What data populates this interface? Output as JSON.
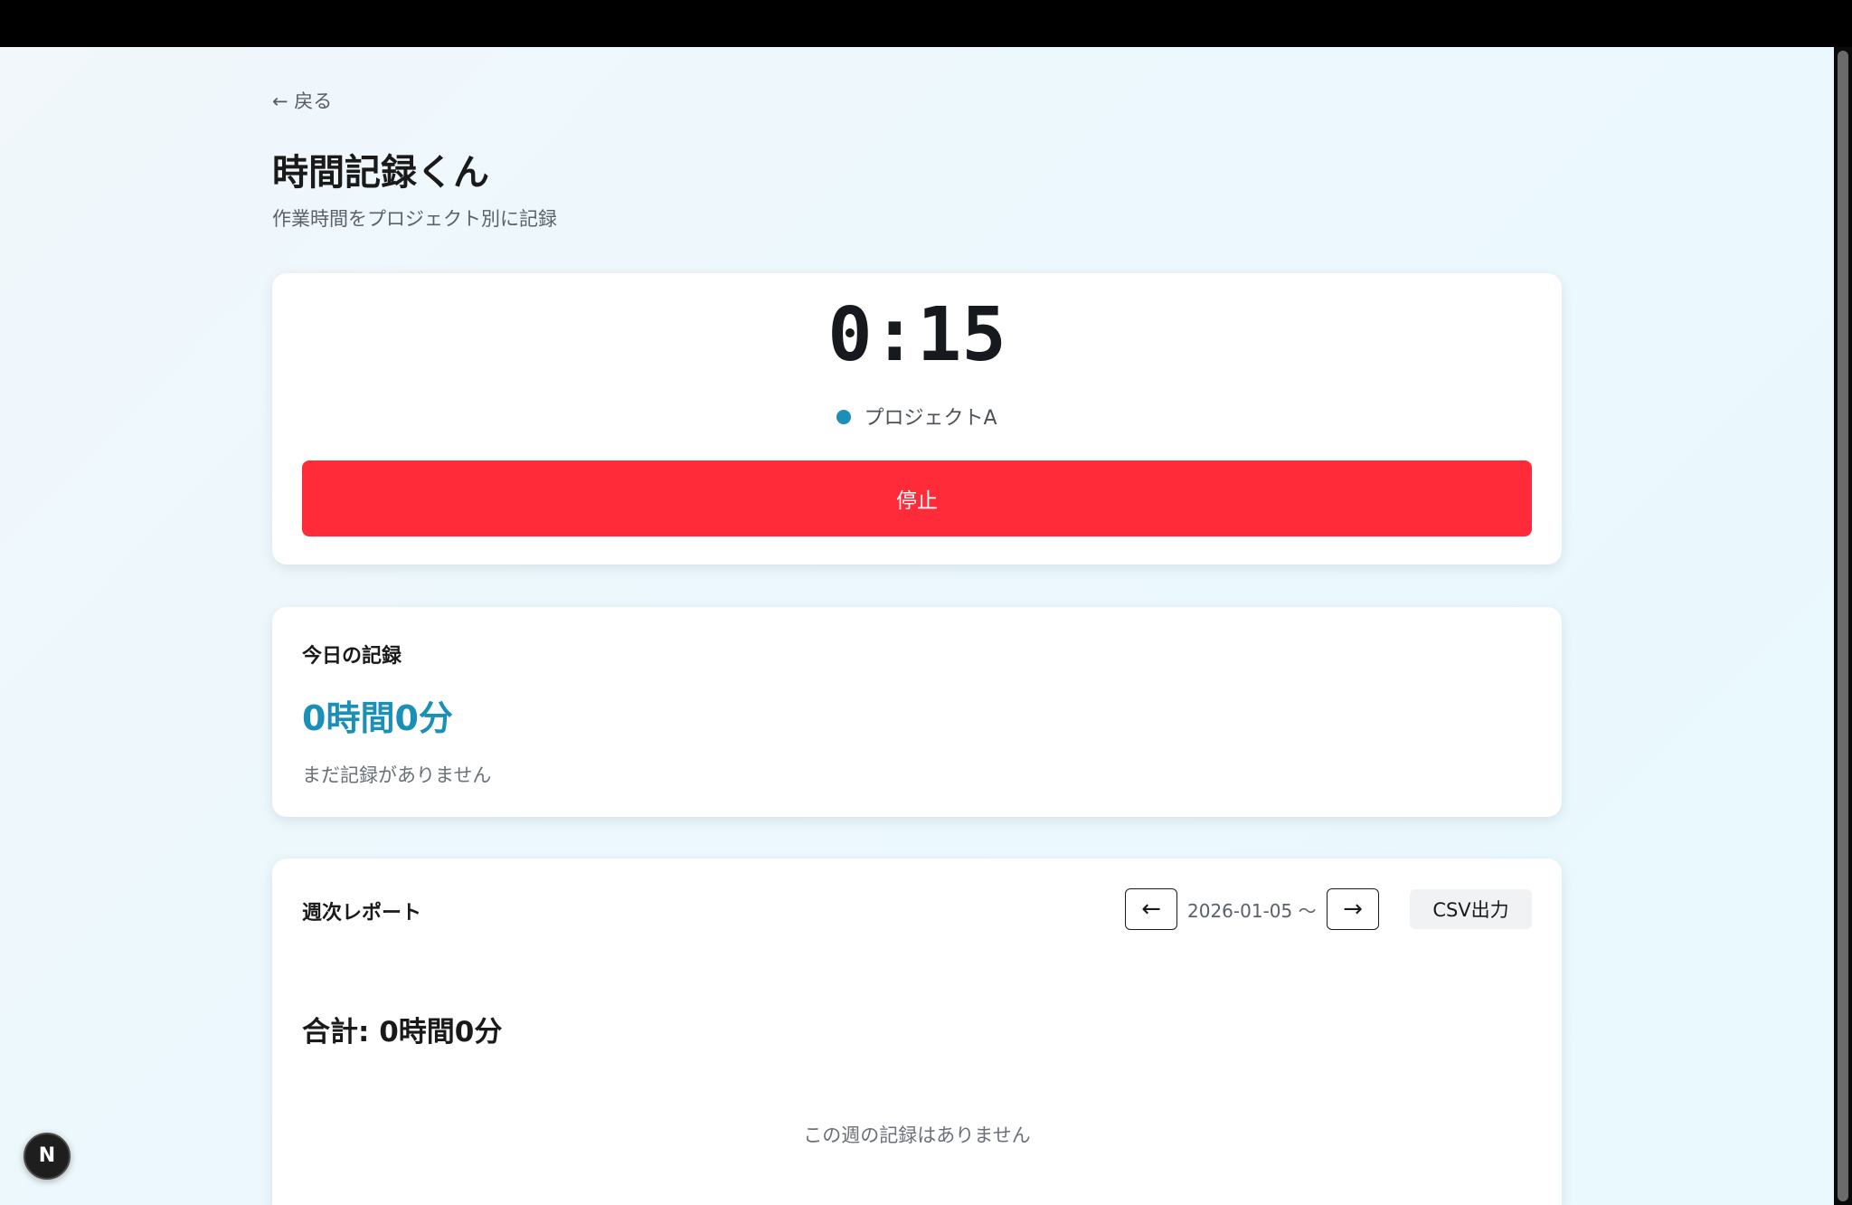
{
  "nav": {
    "back_label": "← 戻る"
  },
  "header": {
    "title": "時間記録くん",
    "subtitle": "作業時間をプロジェクト別に記録"
  },
  "timer": {
    "elapsed": "0:15",
    "project_name": "プロジェクトA",
    "project_color": "#1a8fb8",
    "stop_label": "停止",
    "stop_color": "#ff2b38"
  },
  "today": {
    "title": "今日の記録",
    "total": "0時間0分",
    "total_color": "#1a8fb8",
    "empty_text": "まだ記録がありません"
  },
  "weekly": {
    "title": "週次レポート",
    "prev_label": "←",
    "range_label": "2026-01-05 〜",
    "next_label": "→",
    "csv_label": "CSV出力",
    "total": "合計: 0時間0分",
    "empty_text": "この週の記録はありません"
  },
  "dev_badge": {
    "label": "N"
  }
}
